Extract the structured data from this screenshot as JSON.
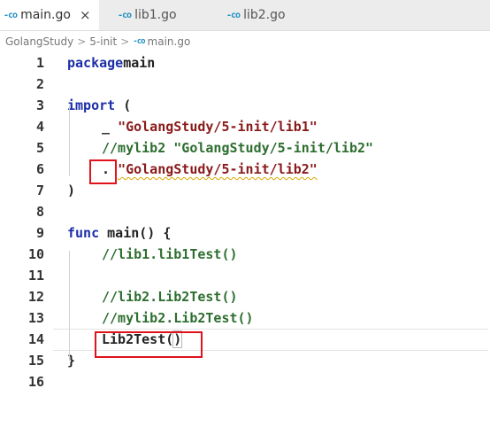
{
  "tabs": [
    {
      "label": "main.go",
      "icon": "go-file-icon",
      "active": true,
      "close": "×"
    },
    {
      "label": "lib1.go",
      "icon": "go-file-icon",
      "active": false
    },
    {
      "label": "lib2.go",
      "icon": "go-file-icon",
      "active": false
    }
  ],
  "breadcrumb": [
    "GolangStudy",
    "5-init",
    "main.go"
  ],
  "breadcrumb_sep": ">",
  "icon_glyph": "-co",
  "lines": [
    {
      "n": "1",
      "parts": [
        [
          "kw",
          "package"
        ],
        [
          "",
          "main"
        ]
      ]
    },
    {
      "n": "2",
      "parts": []
    },
    {
      "n": "3",
      "parts": [
        [
          "kw",
          "import"
        ],
        [
          "",
          " ("
        ]
      ]
    },
    {
      "n": "4",
      "parts": [
        [
          "",
          "_ "
        ],
        [
          "str",
          "\"GolangStudy/5-init/lib1\""
        ]
      ]
    },
    {
      "n": "5",
      "parts": [
        [
          "cmt",
          "//mylib2 \"GolangStudy/5-init/lib2\""
        ]
      ]
    },
    {
      "n": "6",
      "parts": [
        [
          "",
          ". "
        ],
        [
          "str squiggle",
          "\"GolangStudy/5-init/lib2\""
        ]
      ]
    },
    {
      "n": "7",
      "parts": [
        [
          "",
          ")"
        ]
      ]
    },
    {
      "n": "8",
      "parts": []
    },
    {
      "n": "9",
      "parts": [
        [
          "kw",
          "func"
        ],
        [
          "",
          " main() {"
        ]
      ]
    },
    {
      "n": "10",
      "parts": [
        [
          "cmt",
          "//lib1.lib1Test()"
        ]
      ]
    },
    {
      "n": "11",
      "parts": []
    },
    {
      "n": "12",
      "parts": [
        [
          "cmt",
          "//lib2.Lib2Test()"
        ]
      ]
    },
    {
      "n": "13",
      "parts": [
        [
          "cmt",
          "//mylib2.Lib2Test()"
        ]
      ]
    },
    {
      "n": "14",
      "parts": [
        [
          "",
          "Lib2Test("
        ],
        [
          "paren-match",
          ")"
        ]
      ]
    },
    {
      "n": "15",
      "parts": [
        [
          "",
          "}"
        ]
      ]
    },
    {
      "n": "16",
      "parts": []
    }
  ]
}
